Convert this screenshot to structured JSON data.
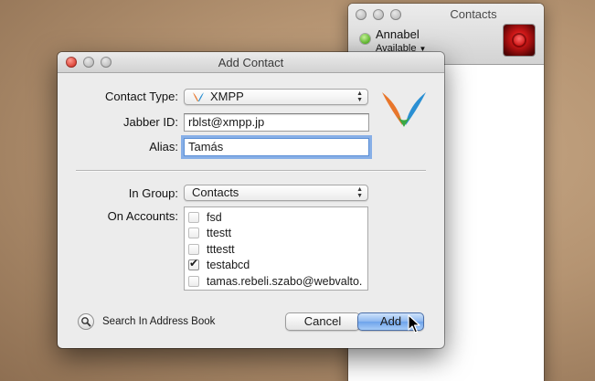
{
  "contacts_window": {
    "title": "Contacts",
    "user": {
      "name": "Annabel",
      "status": "Available"
    }
  },
  "dialog": {
    "title": "Add Contact",
    "contact_type": {
      "label": "Contact Type:",
      "value": "XMPP"
    },
    "jabber_id": {
      "label": "Jabber ID:",
      "value": "rblst@xmpp.jp"
    },
    "alias": {
      "label": "Alias:",
      "value": "Tamás"
    },
    "in_group": {
      "label": "In Group:",
      "value": "Contacts"
    },
    "on_accounts": {
      "label": "On Accounts:",
      "accounts": [
        {
          "name": "fsd",
          "checked": false
        },
        {
          "name": "ttestt",
          "checked": false
        },
        {
          "name": "tttestt",
          "checked": false
        },
        {
          "name": "testabcd",
          "checked": true
        },
        {
          "name": "tamas.rebeli.szabo@webvalto.",
          "checked": false
        }
      ]
    },
    "search_address_book": "Search In Address Book",
    "cancel_label": "Cancel",
    "add_label": "Add"
  },
  "colors": {
    "desktop": "#b59472",
    "default_button": "#6ea3eb",
    "focus_ring": "#659be6",
    "status_available": "#5cb82a"
  },
  "icons": {
    "service": "xmpp-logo-icon",
    "search": "magnifying-glass-icon"
  }
}
